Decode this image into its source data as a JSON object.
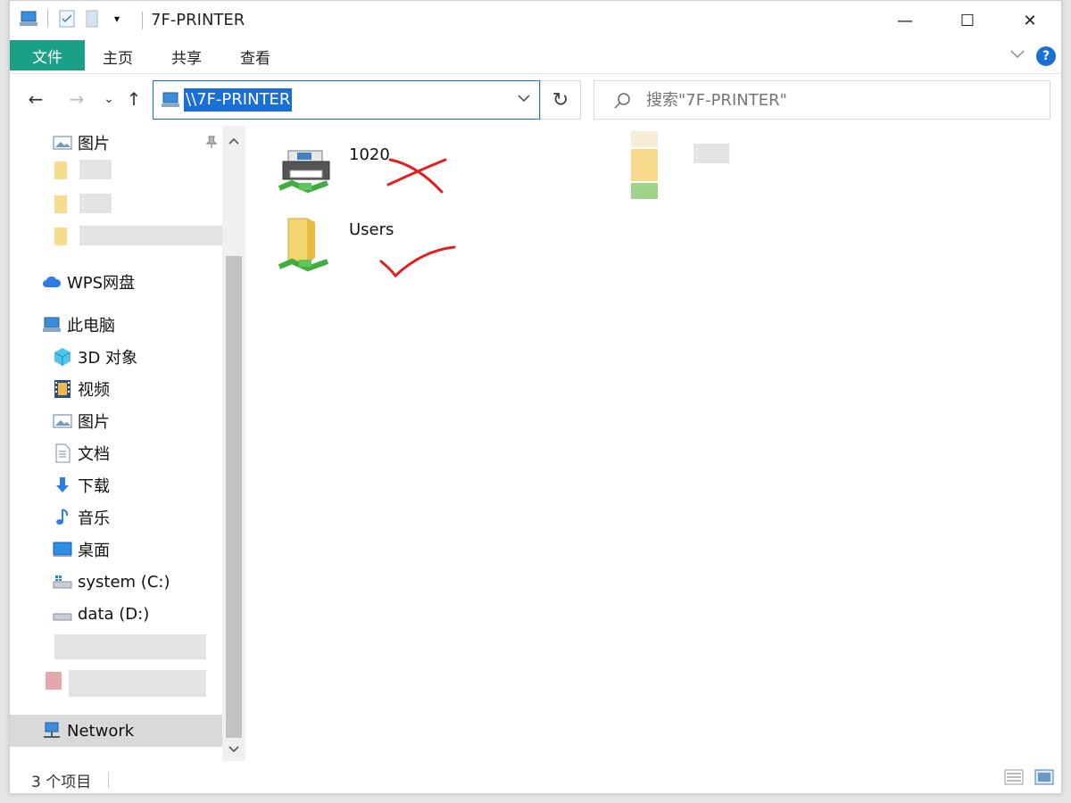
{
  "window": {
    "title": "7F-PRINTER",
    "minimize_label": "—",
    "maximize_label": "☐",
    "close_label": "✕"
  },
  "ribbon": {
    "tabs": [
      {
        "label": "文件",
        "active": true
      },
      {
        "label": "主页"
      },
      {
        "label": "共享"
      },
      {
        "label": "查看"
      }
    ],
    "accent_color": "#19a086",
    "help_label": "?"
  },
  "nav": {
    "back": "←",
    "forward": "→",
    "recent": "⌄",
    "up": "↑",
    "address": "\\\\7F-PRINTER",
    "refresh": "↻",
    "search_placeholder": "搜索\"7F-PRINTER\""
  },
  "sidebar": {
    "items": [
      {
        "label": "图片",
        "icon": "pictures-icon"
      },
      {
        "label": "WPS网盘",
        "icon": "cloud-icon"
      },
      {
        "label": "此电脑",
        "icon": "computer-icon"
      },
      {
        "label": "3D 对象",
        "icon": "3d-objects-icon"
      },
      {
        "label": "视频",
        "icon": "video-icon"
      },
      {
        "label": "图片",
        "icon": "pictures-icon"
      },
      {
        "label": "文档",
        "icon": "document-icon"
      },
      {
        "label": "下载",
        "icon": "download-icon"
      },
      {
        "label": "音乐",
        "icon": "music-icon"
      },
      {
        "label": "桌面",
        "icon": "desktop-icon"
      },
      {
        "label": "system (C:)",
        "icon": "drive-c-icon"
      },
      {
        "label": "data (D:)",
        "icon": "drive-d-icon"
      },
      {
        "label": "Network",
        "icon": "network-icon",
        "selected": true
      }
    ]
  },
  "content": {
    "items": [
      {
        "label": "1020",
        "type": "shared-printer"
      },
      {
        "label": "Users",
        "type": "shared-folder"
      }
    ],
    "annotation_color": "#e0201f"
  },
  "status": {
    "item_count": "3 个项目"
  }
}
